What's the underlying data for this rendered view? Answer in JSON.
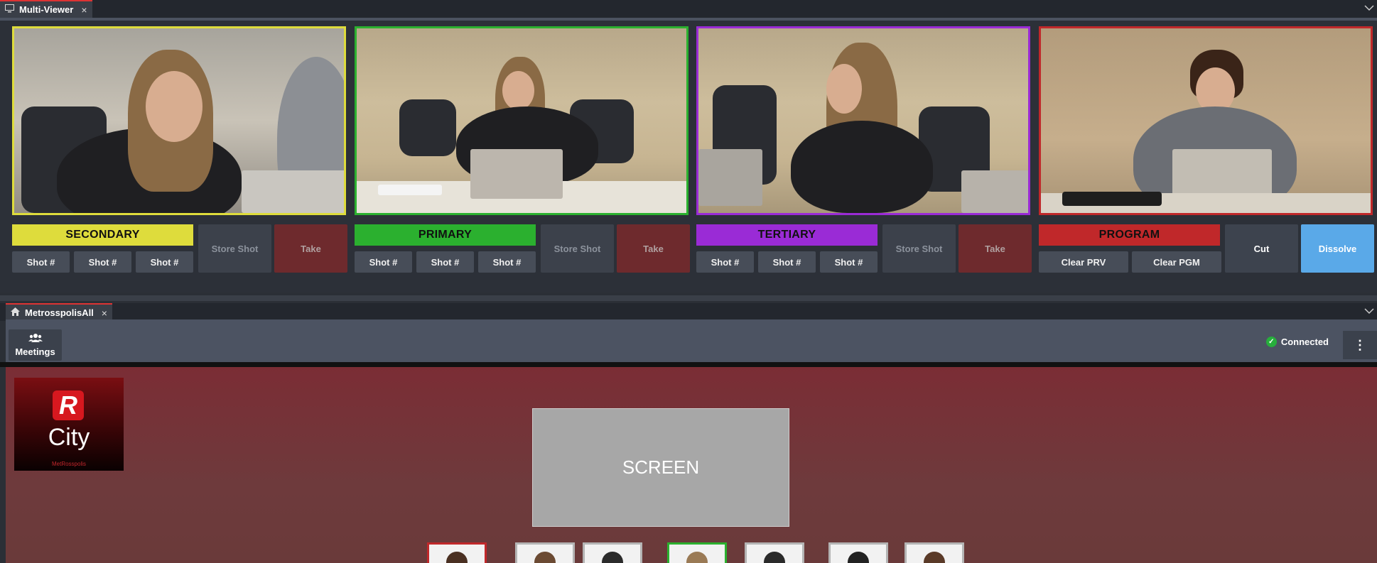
{
  "top_tab": {
    "title": "Multi-Viewer",
    "close": "×"
  },
  "panels": [
    {
      "label": "SECONDARY",
      "color": "#dedc3c",
      "shots": [
        "Shot #",
        "Shot #",
        "Shot #"
      ],
      "store": "Store Shot",
      "take": "Take"
    },
    {
      "label": "PRIMARY",
      "color": "#2bb02f",
      "shots": [
        "Shot #",
        "Shot #",
        "Shot #"
      ],
      "store": "Store Shot",
      "take": "Take"
    },
    {
      "label": "TERTIARY",
      "color": "#9a2bd6",
      "shots": [
        "Shot #",
        "Shot #",
        "Shot #"
      ],
      "store": "Store Shot",
      "take": "Take"
    },
    {
      "label": "PROGRAM",
      "color": "#c0282a",
      "clear_prv": "Clear PRV",
      "clear_pgm": "Clear PGM",
      "cut": "Cut",
      "dissolve": "Dissolve"
    }
  ],
  "second_tab": {
    "title": "MetrosspolisAll",
    "close": "×"
  },
  "toolbar": {
    "meetings_label": "Meetings",
    "status_label": "Connected",
    "status_color": "#27ae3c"
  },
  "room": {
    "logo_letter": "R",
    "logo_city": "City",
    "logo_small": "MetRosspolis",
    "screen_label": "SCREEN"
  },
  "icons": [
    "monitor-icon",
    "home-icon",
    "users-icon",
    "check-circle-icon",
    "more-vertical-icon",
    "chevron-down-icon"
  ]
}
